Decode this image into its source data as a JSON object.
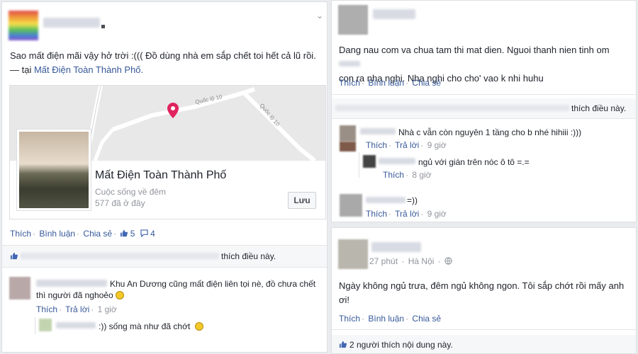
{
  "left_post": {
    "text": "Sao mất điện mãi vậy hở trời :((( Đồ dùng nhà em sắp chết toi hết cả lũ rồi. — tại",
    "place_link": "Mất Điện Toàn Thành Phố.",
    "map": {
      "road_label_1": "Quốc lộ 10",
      "road_label_2": "Quốc lộ 10"
    },
    "place_card": {
      "name": "Mất Điện Toàn Thành Phố",
      "category": "Cuộc sống về đêm",
      "checkins": "577 đã ở đây",
      "save_label": "Lưu"
    },
    "actions": {
      "like": "Thích",
      "comment": "Bình luận",
      "share": "Chia sẻ",
      "like_count": "5",
      "comment_count": "4"
    },
    "likes_suffix": "thích điều này.",
    "comments": [
      {
        "text": "Khu An Dương cũng mất điện liên tọi nè, đồ chưa chết thì người đã nghoẻo",
        "like": "Thích",
        "reply": "Trả lời",
        "time": "1 giờ"
      },
      {
        "text": ":)) sống mà như đã chớt"
      }
    ]
  },
  "right_post_1": {
    "text_line_1": "Dang nau com va chua tam thi mat dien. Nguoi thanh nien tinh om",
    "text_line_2": "con ra nha nghi. Nha nghi cho cho' vao k nhi huhu",
    "actions": {
      "like": "Thích",
      "comment": "Bình luận",
      "share": "Chia sẻ"
    },
    "likes_suffix": "thích điều này.",
    "comments": [
      {
        "text": "Nhà c vẫn còn nguyên 1 tầng cho b nhé hihiii :)))",
        "like": "Thích",
        "reply": "Trả lời",
        "time": "9 giờ"
      },
      {
        "text": "ngủ với gián trên nóc ô tô =.=",
        "like": "Thích",
        "time": "8 giờ"
      },
      {
        "text": "=))",
        "like": "Thích",
        "reply": "Trả lời",
        "time": "9 giờ"
      }
    ]
  },
  "right_post_2": {
    "time": "27 phút",
    "location": "Hà Nội",
    "text_line_1": "Ngày không ngủ trưa, đêm ngủ không ngon. Tôi sắp chớt rồi mấy anh",
    "text_line_2": "ơi!",
    "actions": {
      "like": "Thích",
      "comment": "Bình luận",
      "share": "Chia sẻ"
    },
    "likes_text": "2 người thích nội dung này."
  },
  "colors": {
    "link": "#365899",
    "pin": "#e0245e",
    "like_blue": "#4267b2"
  }
}
